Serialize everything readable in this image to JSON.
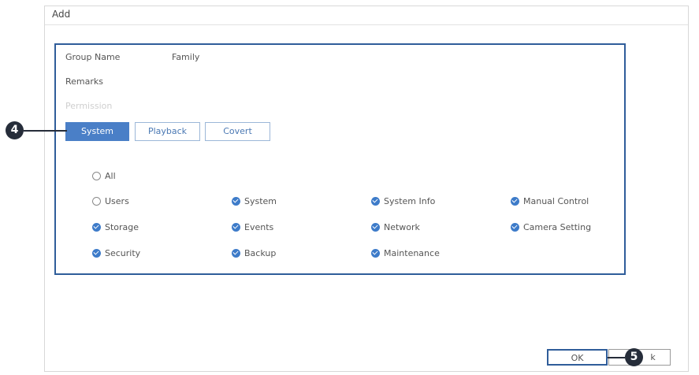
{
  "dialog": {
    "title": "Add"
  },
  "form": {
    "group_name_label": "Group Name",
    "group_name_value": "Family",
    "remarks_label": "Remarks",
    "permission_label": "Permission"
  },
  "tabs": [
    {
      "label": "System",
      "active": true
    },
    {
      "label": "Playback",
      "active": false
    },
    {
      "label": "Covert",
      "active": false
    }
  ],
  "permissions": {
    "all": {
      "label": "All",
      "checked": false
    },
    "items": [
      {
        "label": "Users",
        "checked": false
      },
      {
        "label": "System",
        "checked": true
      },
      {
        "label": "System Info",
        "checked": true
      },
      {
        "label": "Manual Control",
        "checked": true
      },
      {
        "label": "Storage",
        "checked": true
      },
      {
        "label": "Events",
        "checked": true
      },
      {
        "label": "Network",
        "checked": true
      },
      {
        "label": "Camera Setting",
        "checked": true
      },
      {
        "label": "Security",
        "checked": true
      },
      {
        "label": "Backup",
        "checked": true
      },
      {
        "label": "Maintenance",
        "checked": true
      }
    ]
  },
  "buttons": {
    "ok": "OK",
    "back_partial": "k"
  },
  "callouts": {
    "tabs_step": "4",
    "ok_step": "5"
  },
  "colors": {
    "accent": "#4a7fc7",
    "highlight": "#2f5d9a",
    "callout": "#262d3a"
  }
}
